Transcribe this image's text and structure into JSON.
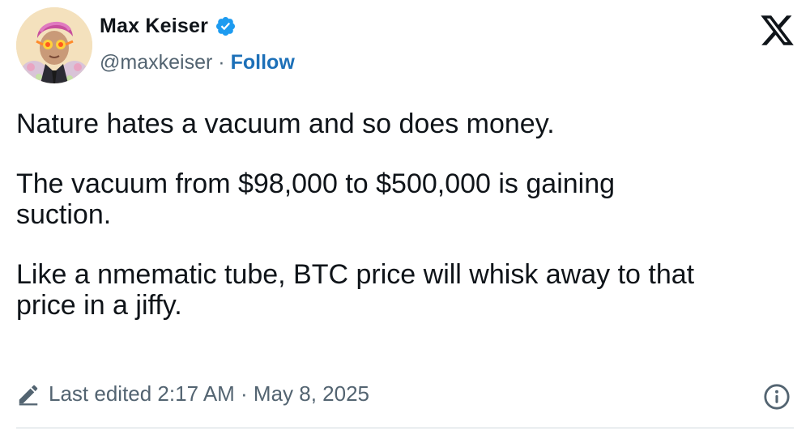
{
  "author": {
    "name": "Max Keiser",
    "handle": "@maxkeiser",
    "follow_label": "Follow",
    "separator": "·",
    "verified": true
  },
  "icons": {
    "verified": "verified-badge-icon",
    "platform": "x-logo-icon",
    "edited": "pencil-icon",
    "info": "info-icon"
  },
  "colors": {
    "follow": "#1d70b8",
    "verified": "#1d9bf0",
    "muted": "#536471",
    "text": "#0f1419"
  },
  "tweet": {
    "paragraph_1": "Nature hates a vacuum and so does money.",
    "paragraph_2": "The vacuum from $98,000 to $500,000 is gaining\nsuction.",
    "paragraph_3": "Like a nmematic tube, BTC price will whisk away to that\nprice in a jiffy."
  },
  "meta": {
    "edited_text": "Last edited 2:17 AM · May 8, 2025"
  }
}
